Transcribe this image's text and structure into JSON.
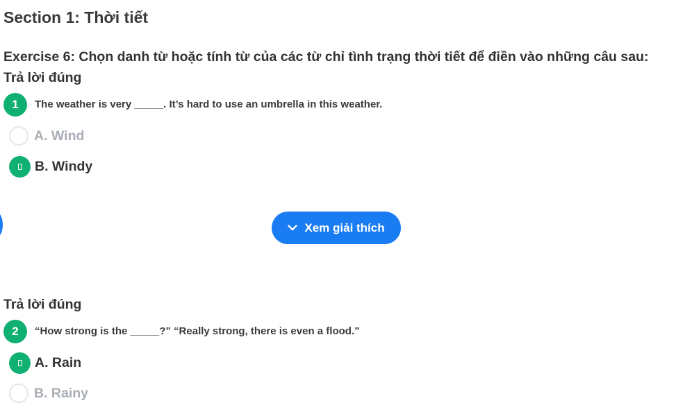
{
  "section": {
    "title": "Section 1: Thời tiết"
  },
  "exercise": {
    "title": "Exercise 6: Chọn danh từ hoặc tính từ của các từ chỉ tình trạng thời tiết để điền vào những câu sau:"
  },
  "questions": [
    {
      "status_label": "Trả lời đúng",
      "number": "1",
      "text": "The weather is very _____. It’s hard to use an umbrella in this weather.",
      "options": [
        {
          "label": "A. Wind",
          "selected": false,
          "icon": "empty-radio-icon"
        },
        {
          "label": "B. Windy",
          "selected": true,
          "icon": "check-icon"
        }
      ]
    },
    {
      "status_label": "Trả lời đúng",
      "number": "2",
      "text": "“How strong is the _____?” “Really strong, there is even a flood.”",
      "options": [
        {
          "label": "A. Rain",
          "selected": true,
          "icon": "check-icon"
        },
        {
          "label": "B. Rainy",
          "selected": false,
          "icon": "empty-radio-icon"
        }
      ]
    }
  ],
  "explain_button": {
    "label": "Xem giải thích",
    "icon": "chevron-down-icon"
  },
  "colors": {
    "accent_green": "#10b072",
    "accent_blue": "#1a7cf2",
    "muted_text": "#a9adb5",
    "text": "#333333"
  }
}
